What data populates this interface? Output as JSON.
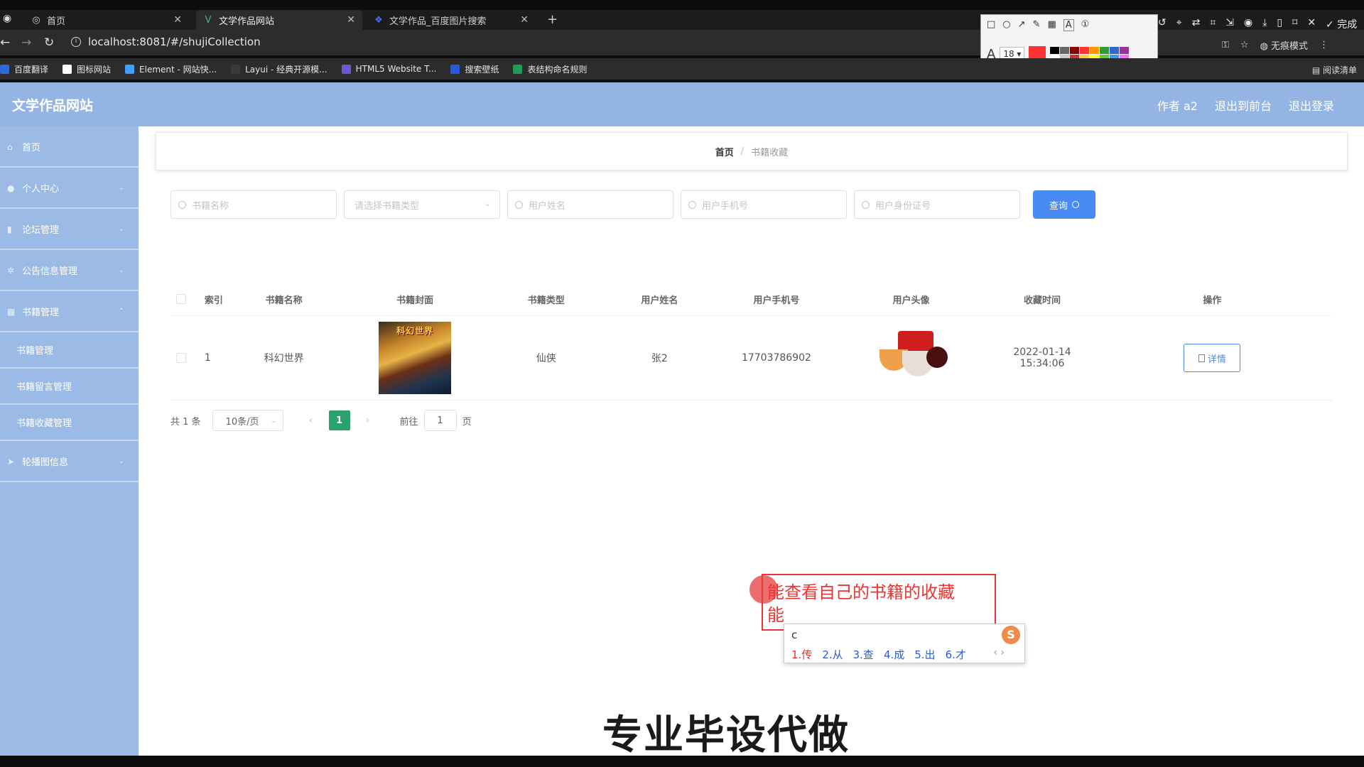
{
  "browser": {
    "tabs": [
      {
        "label": "首页",
        "icon": "globe-icon"
      },
      {
        "label": "文学作品网站",
        "icon": "vue-icon"
      },
      {
        "label": "文学作品_百度图片搜索",
        "icon": "baidu-icon"
      }
    ],
    "url": "localhost:8081/#/shujiCollection",
    "bookmarks": [
      "百度翻译",
      "图标网站",
      "Element - 网站快...",
      "Layui - 经典开源模...",
      "HTML5 Website T...",
      "搜索壁纸",
      "表结构命名规则"
    ],
    "reading_list": "阅读清单",
    "incognito": "无痕模式",
    "done": "完成",
    "annot_font_size": "18"
  },
  "app": {
    "brand": "文学作品网站",
    "header_links": [
      "作者 a2",
      "退出到前台",
      "退出登录"
    ]
  },
  "sidebar": {
    "items": [
      {
        "label": "首页"
      },
      {
        "label": "个人中心"
      },
      {
        "label": "论坛管理"
      },
      {
        "label": "公告信息管理"
      },
      {
        "label": "书籍管理"
      }
    ],
    "sub_items": [
      "书籍管理",
      "书籍留言管理",
      "书籍收藏管理"
    ],
    "last_item": "轮播图信息"
  },
  "breadcrumb": {
    "home": "首页",
    "sep": "/",
    "current": "书籍收藏"
  },
  "search": {
    "book_name_placeholder": "书籍名称",
    "book_type_placeholder": "请选择书籍类型",
    "user_name_placeholder": "用户姓名",
    "user_phone_placeholder": "用户手机号",
    "user_id_placeholder": "用户身份证号",
    "query_label": "查询"
  },
  "table": {
    "headers": [
      "索引",
      "书籍名称",
      "书籍封面",
      "书籍类型",
      "用户姓名",
      "用户手机号",
      "用户头像",
      "收藏时间",
      "操作"
    ],
    "rows": [
      {
        "index": "1",
        "book_name": "科幻世界",
        "cover_text": "科幻世界",
        "book_type": "仙侠",
        "user_name": "张2",
        "phone": "17703786902",
        "time": "2022-01-14 15:34:06",
        "action": "详情"
      }
    ]
  },
  "pagination": {
    "total": "共 1 条",
    "page_size": "10条/页",
    "current_page": "1",
    "goto_prefix": "前往",
    "goto_value": "1",
    "goto_suffix": "页"
  },
  "overlay": {
    "note_line1": "能查看自己的书籍的收藏",
    "note_line2": "能",
    "ime_composition": "c",
    "ime_candidates": [
      "1.传",
      "2.从",
      "3.查",
      "4.成",
      "5.出",
      "6.才"
    ],
    "watermark": "专业毕设代做"
  },
  "colors": {
    "header_bg": "#94b5e3",
    "sidebar_bg": "#9bbbe6",
    "primary": "#4a8af4",
    "pager_active": "#27a36b",
    "annotation_red": "#e33333"
  }
}
